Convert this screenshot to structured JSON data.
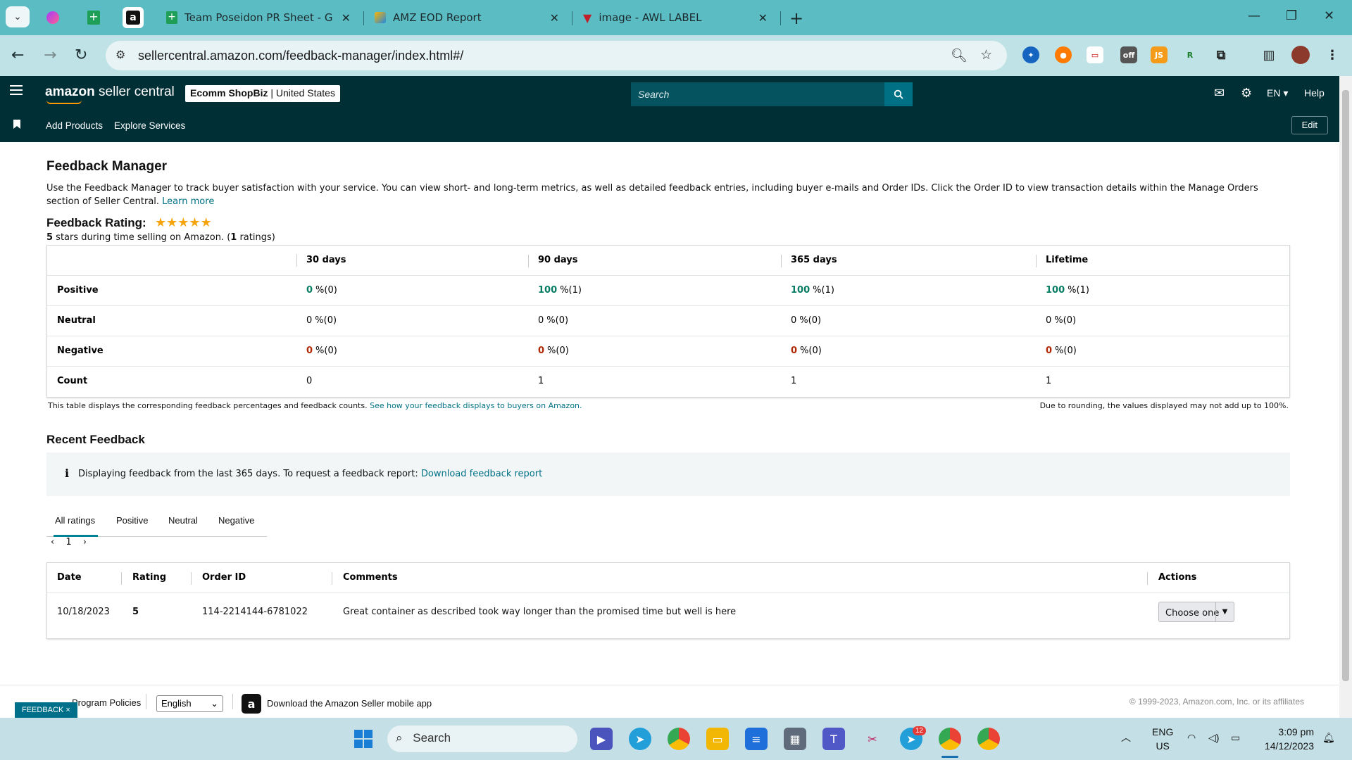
{
  "browser": {
    "tabs": [
      {
        "title": "Team Poseidon PR Sheet - Goo"
      },
      {
        "title": "AMZ EOD Report"
      },
      {
        "title": "image - AWL LABEL"
      }
    ],
    "url": "sellercentral.amazon.com/feedback-manager/index.html#/"
  },
  "header": {
    "logo_brand": "amazon",
    "logo_product": "seller central",
    "store_name": "Ecomm ShopBiz",
    "store_region": "United States",
    "search_placeholder": "Search",
    "language": "EN",
    "help": "Help",
    "subnav": [
      "Add Products",
      "Explore Services"
    ],
    "edit": "Edit"
  },
  "page": {
    "title": "Feedback Manager",
    "description": "Use the Feedback Manager to track buyer satisfaction with your service. You can view short- and long-term metrics, as well as detailed feedback entries, including buyer e-mails and Order IDs. Click the Order ID to view transaction details within the Manage Orders section of Seller Central.",
    "learn_more": "Learn more",
    "rating_label": "Feedback Rating:",
    "rating_stars": 5,
    "rating_value": "5",
    "rating_sub_mid": " stars during time selling on Amazon. (",
    "rating_count": "1",
    "rating_sub_end": " ratings)"
  },
  "feedback_table": {
    "columns": [
      "30 days",
      "90 days",
      "365 days",
      "Lifetime"
    ],
    "rows": [
      {
        "label": "Positive",
        "cells": [
          {
            "n": "0",
            "r": "%(0)"
          },
          {
            "n": "100",
            "r": "%(1)"
          },
          {
            "n": "100",
            "r": "%(1)"
          },
          {
            "n": "100",
            "r": "%(1)"
          }
        ]
      },
      {
        "label": "Neutral",
        "cells": [
          {
            "n": "0",
            "r": "%(0)"
          },
          {
            "n": "0",
            "r": "%(0)"
          },
          {
            "n": "0",
            "r": "%(0)"
          },
          {
            "n": "0",
            "r": "%(0)"
          }
        ]
      },
      {
        "label": "Negative",
        "cells": [
          {
            "n": "0",
            "r": "%(0)"
          },
          {
            "n": "0",
            "r": "%(0)"
          },
          {
            "n": "0",
            "r": "%(0)"
          },
          {
            "n": "0",
            "r": "%(0)"
          }
        ]
      },
      {
        "label": "Count",
        "cells": [
          {
            "n": "0",
            "r": ""
          },
          {
            "n": "1",
            "r": ""
          },
          {
            "n": "1",
            "r": ""
          },
          {
            "n": "1",
            "r": ""
          }
        ]
      }
    ],
    "note": "This table displays the corresponding feedback percentages and feedback counts.",
    "note_link": "See how your feedback displays to buyers on Amazon.",
    "rounding_note": "Due to rounding, the values displayed may not add up to 100%."
  },
  "recent": {
    "title": "Recent Feedback",
    "info_text": "Displaying feedback from the last 365 days. To request a feedback report:",
    "info_link": "Download feedback report",
    "tabs": [
      "All ratings",
      "Positive",
      "Neutral",
      "Negative"
    ],
    "page": "1",
    "columns": [
      "Date",
      "Rating",
      "Order ID",
      "Comments",
      "Actions"
    ],
    "rows": [
      {
        "date": "10/18/2023",
        "rating": "5",
        "order_id": "114-2214144-6781022",
        "comment": "Great container as described took way longer than the promised time but well is here",
        "action": "Choose one"
      }
    ]
  },
  "footer": {
    "policies": "Program Policies",
    "language": "English",
    "app_text": "Download the Amazon Seller mobile app",
    "copyright": "© 1999-2023, Amazon.com, Inc. or its affiliates",
    "feedback_badge": "FEEDBACK ×"
  },
  "taskbar": {
    "search": "Search",
    "lang_top": "ENG",
    "lang_bottom": "US",
    "time": "3:09 pm",
    "date": "14/12/2023",
    "telegram_badge": "12"
  },
  "colors": {
    "positive": "#067d62",
    "negative": "#b12704",
    "header": "#002f36",
    "link": "#007185"
  }
}
